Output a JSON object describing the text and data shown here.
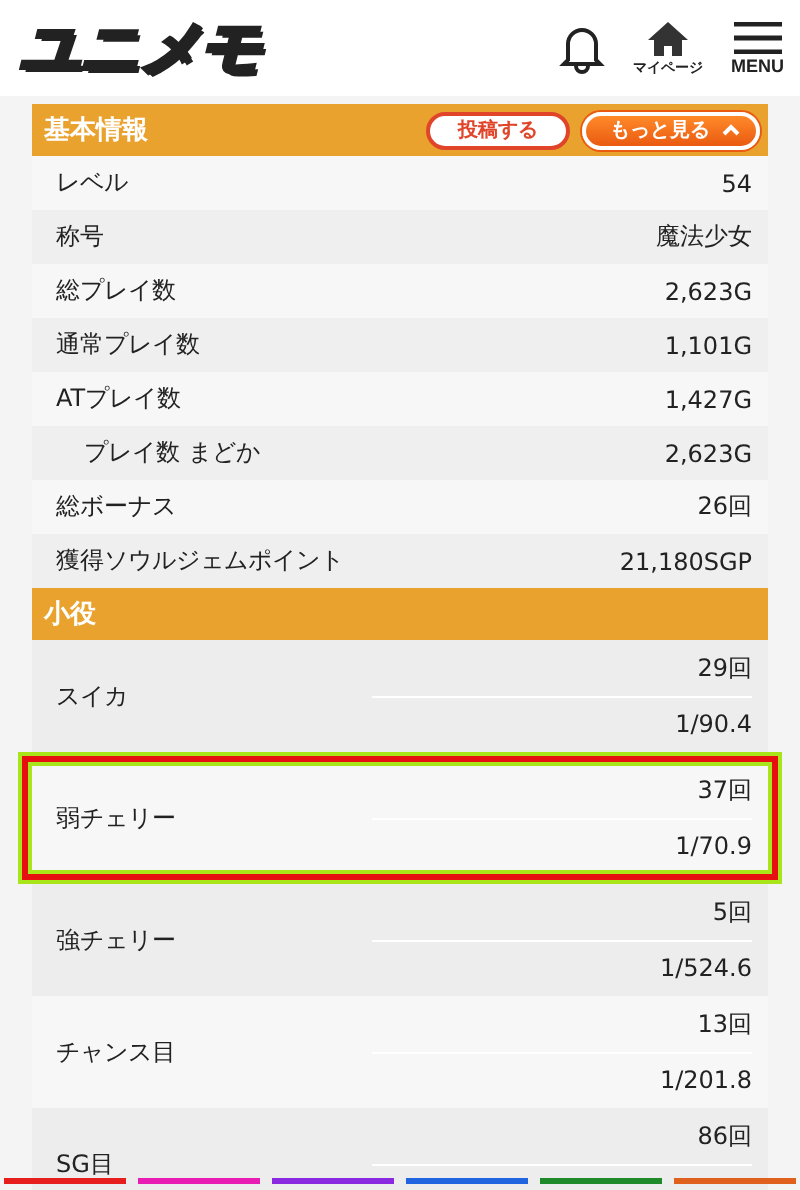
{
  "header": {
    "logo": "ユニメモ",
    "nav": [
      {
        "kind": "bell"
      },
      {
        "kind": "home",
        "label": "マイページ"
      },
      {
        "kind": "menu",
        "label": "MENU"
      }
    ]
  },
  "basic_info": {
    "title": "基本情報",
    "post_button": "投稿する",
    "more_button": "もっと見る",
    "rows": [
      {
        "label": "レベル",
        "value": "54"
      },
      {
        "label": "称号",
        "value": "魔法少女"
      },
      {
        "label": "総プレイ数",
        "value": "2,623G"
      },
      {
        "label": "通常プレイ数",
        "value": "1,101G"
      },
      {
        "label": "ATプレイ数",
        "value": "1,427G",
        "children": [
          {
            "label": "プレイ数 まどか",
            "value": "2,623G"
          }
        ]
      },
      {
        "label": "総ボーナス",
        "value": "26回"
      },
      {
        "label": "獲得ソウルジェムポイント",
        "value": "21,180SGP"
      }
    ]
  },
  "small_roles": {
    "title": "小役",
    "rows": [
      {
        "label": "スイカ",
        "count": "29回",
        "probability": "1/90.4",
        "highlighted": false
      },
      {
        "label": "弱チェリー",
        "count": "37回",
        "probability": "1/70.9",
        "highlighted": true
      },
      {
        "label": "強チェリー",
        "count": "5回",
        "probability": "1/524.6",
        "highlighted": false
      },
      {
        "label": "チャンス目",
        "count": "13回",
        "probability": "1/201.8",
        "highlighted": false
      },
      {
        "label": "SG目",
        "count": "86回",
        "highlighted": false
      }
    ]
  }
}
